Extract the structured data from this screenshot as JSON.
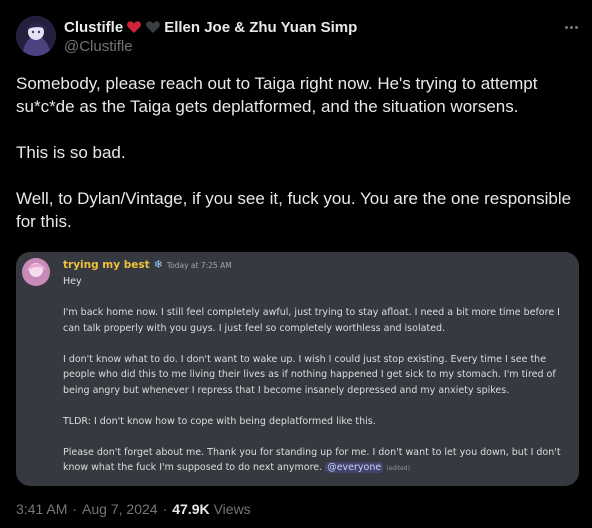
{
  "author": {
    "display_name_start": "Clustifle",
    "display_name_end": "Ellen Joe & Zhu Yuan Simp",
    "heart_icons": [
      "red-heart-icon",
      "black-heart-icon"
    ],
    "heart_colors": [
      "#d0243c",
      "#333639"
    ],
    "handle": "@Clustifle"
  },
  "tweet": {
    "paragraphs": [
      "Somebody, please reach out to Taiga right now. He's trying to attempt su*c*de as the Taiga gets deplatformed, and the situation worsens.",
      "This is so bad.",
      "Well, to Dylan/Vintage, if you see it, fuck you. You are the one responsible for this."
    ]
  },
  "embed": {
    "username": "trying my best",
    "username_color": "#f0c23b",
    "badge_icon": "snowflake-icon",
    "timestamp": "Today at 7:25 AM",
    "lines": [
      "Hey",
      "I'm back home now. I still feel completely awful, just trying to stay afloat. I need a bit more time before I can talk properly with you guys. I just feel so completely worthless and isolated.",
      "I don't know what to do. I don't want to wake up. I wish I could just stop existing. Every time I see the people who did this to me living their lives as if nothing happened I get sick to my stomach. I'm tired of being angry but whenever I repress that I become insanely depressed and my anxiety spikes.",
      "TLDR: I don't know how to cope with being deplatformed like this."
    ],
    "last_line": "Please don't forget about me. Thank you for standing up for me. I don't want to let you down, but I don't know what the fuck I'm supposed to do next anymore.",
    "mention": "@everyone",
    "edited": "(edited)"
  },
  "footer": {
    "time": "3:41 AM",
    "separator": "·",
    "date": "Aug 7, 2024",
    "views_count": "47.9K",
    "views_label": "Views"
  }
}
